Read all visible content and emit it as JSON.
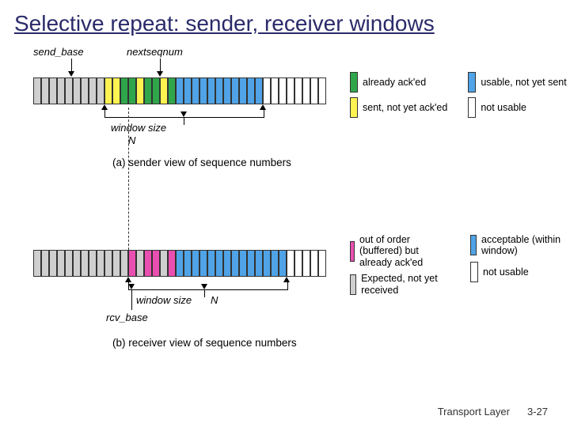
{
  "title": "Selective repeat: sender, receiver windows",
  "sender": {
    "send_base_label": "send_base",
    "nextseqnum_label": "nextseqnum",
    "window_label": "window size",
    "window_var": "N",
    "caption": "(a) sender view of sequence numbers",
    "segments": [
      "grey",
      "grey",
      "grey",
      "grey",
      "grey",
      "grey",
      "grey",
      "grey",
      "grey",
      "yellow",
      "yellow",
      "green",
      "green",
      "yellow",
      "green",
      "green",
      "yellow",
      "green",
      "blue",
      "blue",
      "blue",
      "blue",
      "blue",
      "blue",
      "blue",
      "blue",
      "blue",
      "blue",
      "blue",
      "white",
      "white",
      "white",
      "white",
      "white",
      "white",
      "white",
      "white"
    ],
    "window_start_index": 9,
    "window_end_index": 28,
    "nextseqnum_index": 18
  },
  "receiver": {
    "rcv_base_label": "rcv_base",
    "window_label": "window size",
    "window_var": "N",
    "caption": "(b) receiver view of sequence numbers",
    "segments": [
      "grey",
      "grey",
      "grey",
      "grey",
      "grey",
      "grey",
      "grey",
      "grey",
      "grey",
      "grey",
      "grey",
      "grey",
      "magenta",
      "grey",
      "magenta",
      "magenta",
      "grey",
      "magenta",
      "blue",
      "blue",
      "blue",
      "blue",
      "blue",
      "blue",
      "blue",
      "blue",
      "blue",
      "blue",
      "blue",
      "blue",
      "blue",
      "blue",
      "white",
      "white",
      "white",
      "white",
      "white"
    ],
    "window_start_index": 12,
    "window_end_index": 31
  },
  "legend": {
    "sender": {
      "col1": [
        {
          "color": "green",
          "text": "already ack'ed"
        },
        {
          "color": "yellow",
          "text": "sent, not yet ack'ed"
        }
      ],
      "col2": [
        {
          "color": "blue",
          "text": "usable, not yet sent"
        },
        {
          "color": "white",
          "text": "not usable"
        }
      ]
    },
    "receiver": {
      "col1": [
        {
          "color": "magenta",
          "text": "out of order (buffered) but already ack'ed"
        },
        {
          "color": "grey",
          "text": "Expected, not yet received"
        }
      ],
      "col2": [
        {
          "color": "blue",
          "text": "acceptable (within window)"
        },
        {
          "color": "white",
          "text": "not usable"
        }
      ]
    }
  },
  "footer": {
    "left": "Transport Layer",
    "right": "3-27"
  }
}
